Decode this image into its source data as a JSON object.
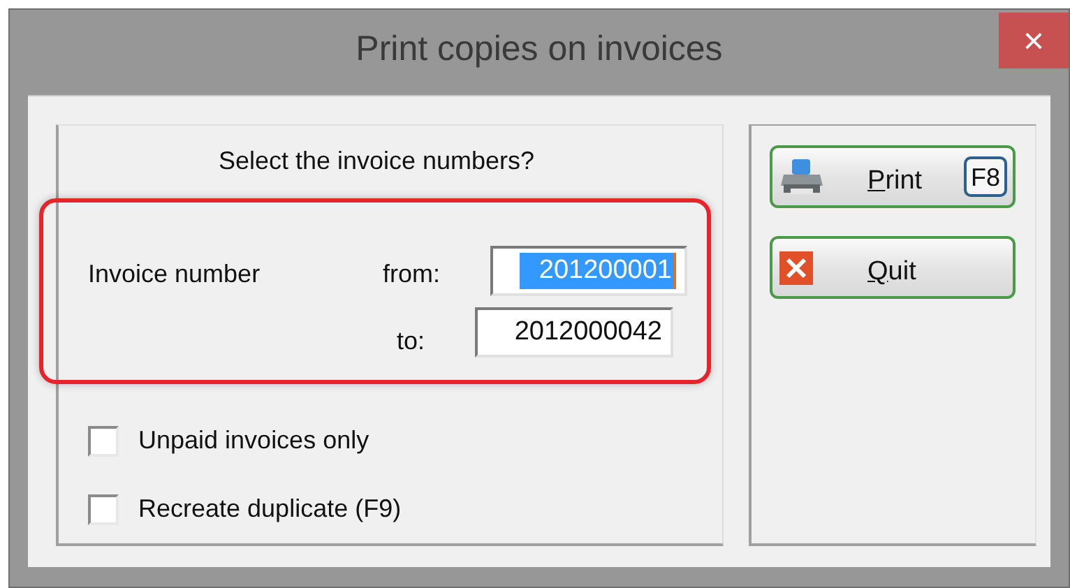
{
  "window": {
    "title": "Print copies on invoices",
    "close": "×"
  },
  "prompt": "Select the invoice numbers?",
  "invoice_range": {
    "highlighted": true,
    "label": "Invoice number",
    "fields": [
      {
        "label": "from:",
        "value": "201200001",
        "text_selected": true
      },
      {
        "label": "to:",
        "value": "2012000042",
        "text_selected": false
      }
    ]
  },
  "options": [
    {
      "label": "Unpaid invoices only",
      "checked": false
    },
    {
      "label": "Recreate duplicate (F9)",
      "checked": false
    }
  ],
  "buttons": [
    {
      "kind": "print",
      "label": "Print",
      "shortcut": "F8"
    },
    {
      "kind": "quit",
      "label": "Quit"
    }
  ]
}
